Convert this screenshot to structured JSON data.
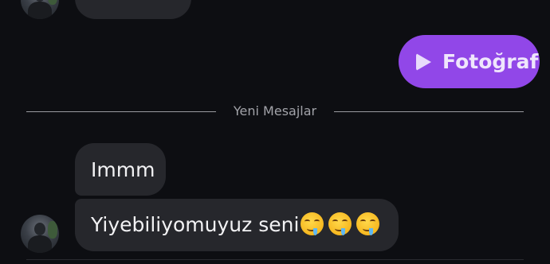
{
  "chat": {
    "previous_message_text": "",
    "outgoing_media_label": "Fotoğraf",
    "new_messages_divider": "Yeni Mesajlar",
    "incoming_messages": [
      {
        "text": "Immm"
      },
      {
        "text": "Yiyebiliyomuyuz seni"
      }
    ],
    "emoji_names": [
      "drooling-face-emoji",
      "drooling-face-emoji",
      "drooling-face-emoji"
    ]
  },
  "colors": {
    "background": "#0d0e12",
    "incoming_bubble": "#26272c",
    "outgoing_bubble": "#9147e8",
    "divider": "#9a9ba1"
  }
}
